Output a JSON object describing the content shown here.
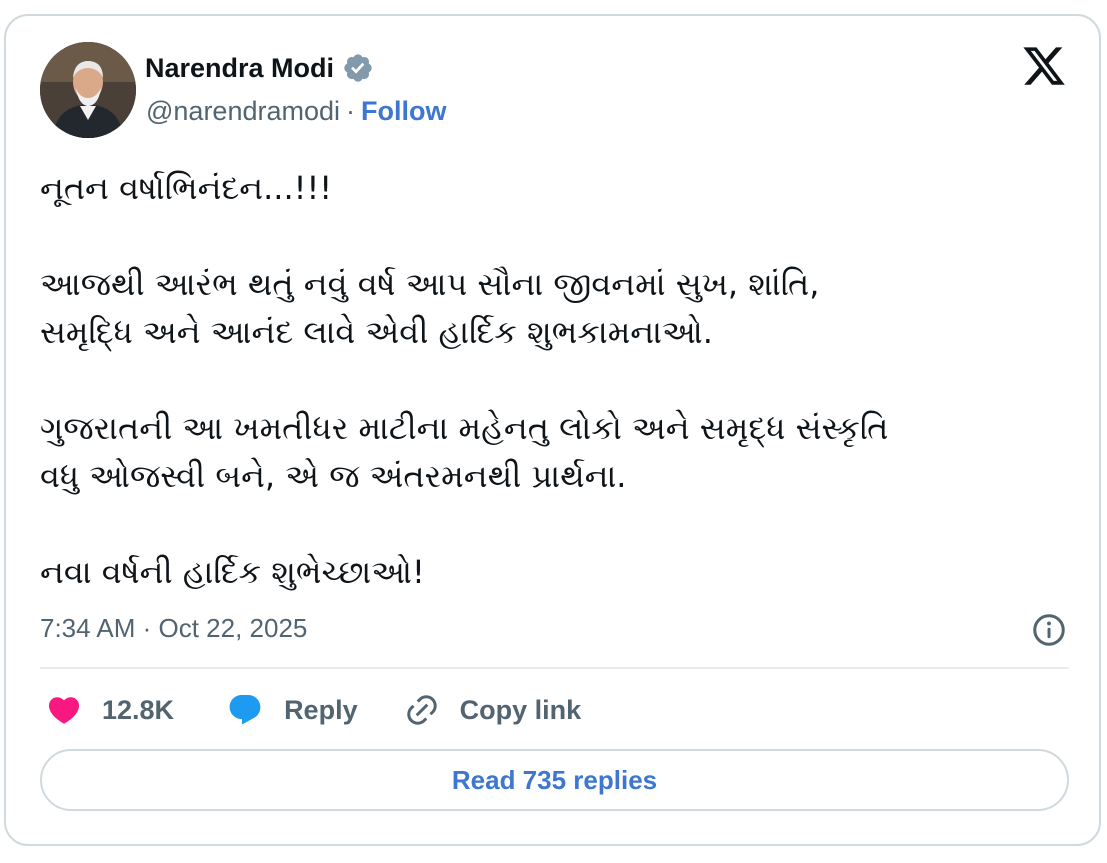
{
  "author": {
    "name": "Narendra Modi",
    "handle": "@narendramodi",
    "separator": "·",
    "follow_label": "Follow"
  },
  "icons": {
    "avatar": "avatar-photo",
    "verified": "verified-badge-icon",
    "brand": "x-logo-icon",
    "info": "info-icon",
    "like": "heart-icon",
    "reply": "speech-bubble-icon",
    "copy": "link-icon"
  },
  "colors": {
    "verified_badge": "#829aab",
    "follow_link": "#3d77cf",
    "heart": "#f91880",
    "reply_bubble": "#1d9bf0",
    "muted_text": "#536471",
    "border": "#cfd9de"
  },
  "tweet": {
    "lines": [
      "નૂતન વર્ષાભિનંદન...!!!",
      "",
      "આજથી આરંભ થતું નવું વર્ષ આપ સૌના જીવનમાં સુખ, શાંતિ,",
      "સમૃદ્ધિ અને આનંદ લાવે એવી હાર્દિક શુભકામનાઓ.",
      "",
      "ગુજરાતની આ ખમતીધર માટીના મહેનતુ લોકો અને સમૃદ્ધ સંસ્કૃતિ",
      "વધુ ઓજસ્વી બને, એ જ અંતરમનથી પ્રાર્થના.",
      "",
      "નવા વર્ષની હાર્દિક શુભેચ્છાઓ!"
    ],
    "timestamp": "7:34 AM · Oct 22, 2025"
  },
  "actions": {
    "like_count": "12.8K",
    "reply_label": "Reply",
    "copy_link_label": "Copy link"
  },
  "footer": {
    "read_replies_label": "Read 735 replies"
  }
}
